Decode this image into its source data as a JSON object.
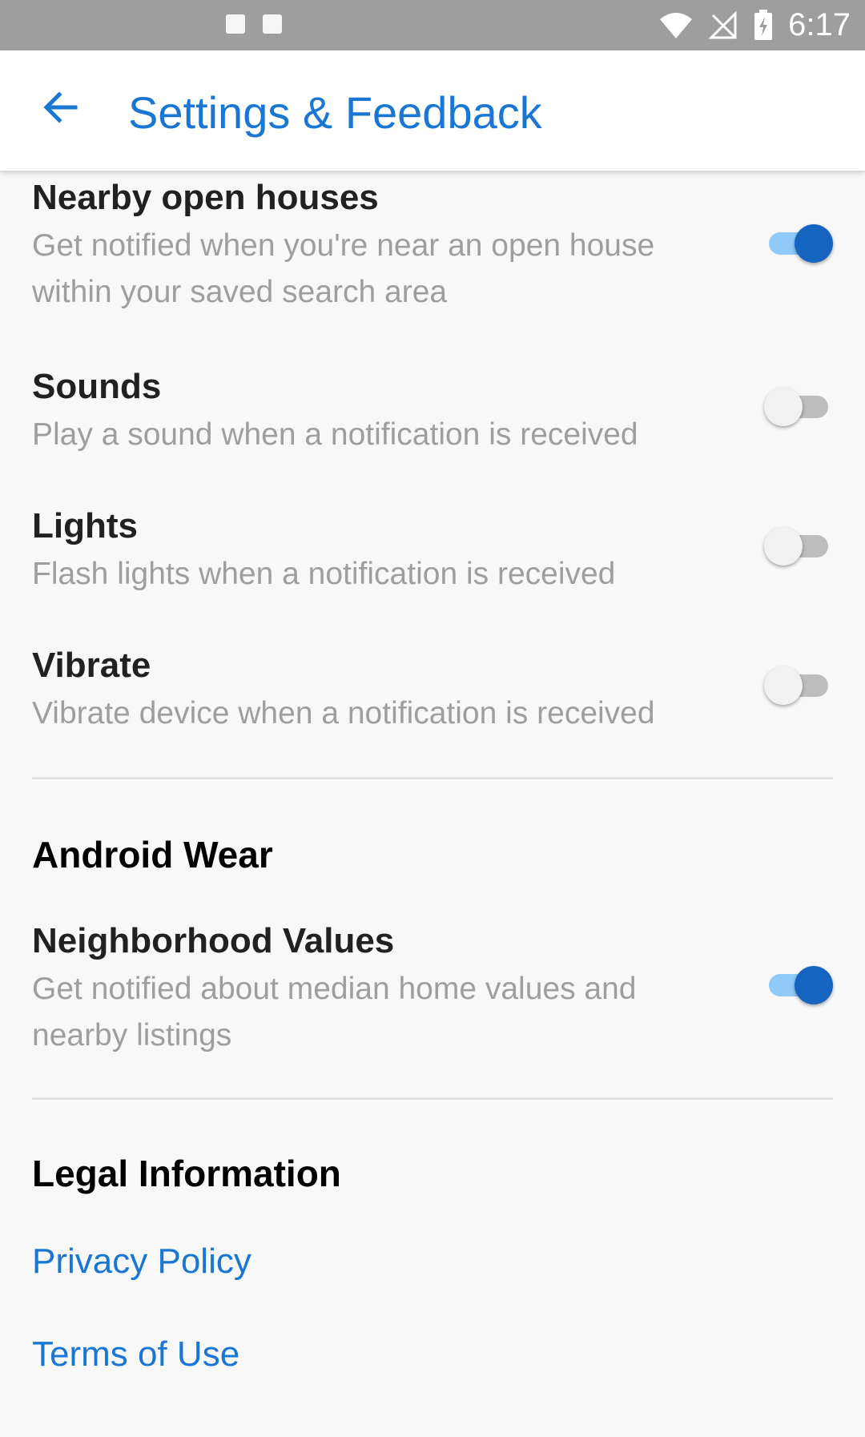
{
  "status_bar": {
    "time": "6:17",
    "icons": [
      "notification-icon",
      "notification-icon-2",
      "wifi-icon",
      "no-signal-icon",
      "battery-charging-icon"
    ]
  },
  "app_bar": {
    "title": "Settings & Feedback",
    "back_icon": "arrow-back-icon"
  },
  "notifications": {
    "items": [
      {
        "title": "Nearby open houses",
        "description": "Get notified when you're near an open house within your saved search area",
        "enabled": true
      },
      {
        "title": "Sounds",
        "description": "Play a sound when a notification is received",
        "enabled": false
      },
      {
        "title": "Lights",
        "description": "Flash lights when a notification is received",
        "enabled": false
      },
      {
        "title": "Vibrate",
        "description": "Vibrate device when a notification is received",
        "enabled": false
      }
    ]
  },
  "android_wear": {
    "header": "Android Wear",
    "items": [
      {
        "title": "Neighborhood Values",
        "description": "Get notified about median home values and nearby listings",
        "enabled": true
      }
    ]
  },
  "legal": {
    "header": "Legal Information",
    "links": [
      "Privacy Policy",
      "Terms of Use"
    ]
  },
  "colors": {
    "accent": "#1976d2",
    "status_bar": "#9e9e9e",
    "background": "#f8f8f8"
  }
}
